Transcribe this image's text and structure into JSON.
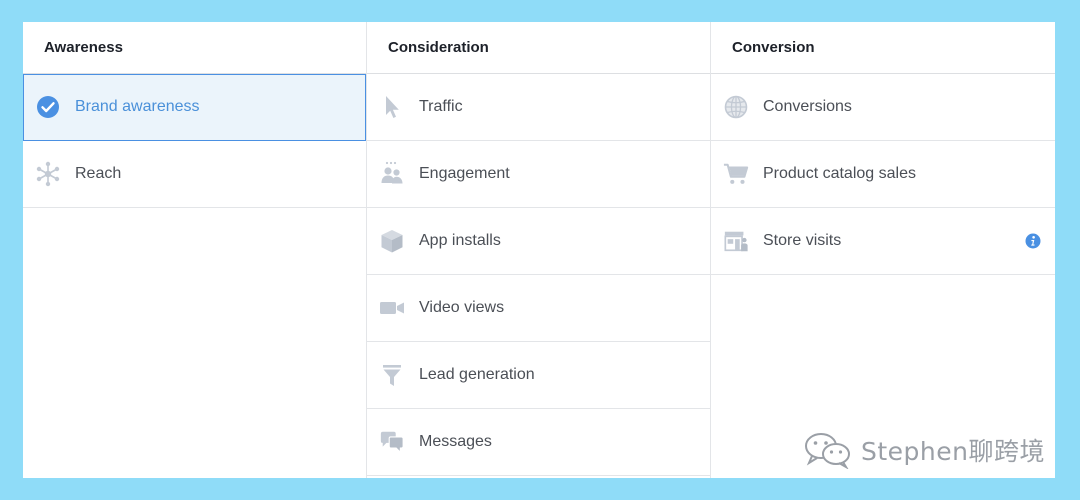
{
  "columns": [
    {
      "header": "Awareness",
      "items": [
        {
          "label": "Brand awareness",
          "icon": "check-circle-icon",
          "selected": true
        },
        {
          "label": "Reach",
          "icon": "reach-icon",
          "selected": false
        }
      ]
    },
    {
      "header": "Consideration",
      "items": [
        {
          "label": "Traffic",
          "icon": "cursor-icon"
        },
        {
          "label": "Engagement",
          "icon": "people-icon"
        },
        {
          "label": "App installs",
          "icon": "box-icon"
        },
        {
          "label": "Video views",
          "icon": "video-camera-icon"
        },
        {
          "label": "Lead generation",
          "icon": "funnel-icon"
        },
        {
          "label": "Messages",
          "icon": "chat-bubbles-icon"
        }
      ]
    },
    {
      "header": "Conversion",
      "items": [
        {
          "label": "Conversions",
          "icon": "globe-icon"
        },
        {
          "label": "Product catalog sales",
          "icon": "shopping-cart-icon"
        },
        {
          "label": "Store visits",
          "icon": "store-icon",
          "info": "info-icon"
        }
      ]
    }
  ],
  "colors": {
    "background": "#8fdcf8",
    "selected_bg": "#ebf4fb",
    "selected_text": "#4a90d9",
    "accent": "#4a90e2",
    "icon_gray": "#c3cad4"
  },
  "watermark": {
    "text": "Stephen聊跨境",
    "icon": "wechat-icon"
  }
}
